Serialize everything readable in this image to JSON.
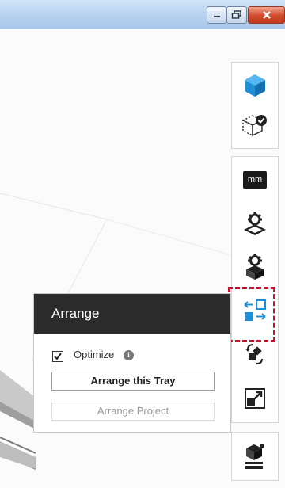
{
  "window": {
    "buttons": [
      {
        "name": "minimize",
        "icon": "minimize-icon"
      },
      {
        "name": "restore",
        "icon": "restore-icon"
      },
      {
        "name": "close",
        "icon": "close-icon"
      }
    ]
  },
  "toolbar": {
    "groups": [
      {
        "items": [
          {
            "icon": "cube-view-icon",
            "color": "#1e8fd6"
          },
          {
            "icon": "dice-check-icon"
          }
        ]
      },
      {
        "items": [
          {
            "icon": "units-mm-icon",
            "label": "mm"
          },
          {
            "icon": "layer-gear-icon"
          },
          {
            "icon": "box-gear-icon"
          },
          {
            "icon": "arrange-icon",
            "color": "#1e8fd6",
            "selected": true
          },
          {
            "icon": "rotate-icon"
          },
          {
            "icon": "scale-icon"
          }
        ]
      },
      {
        "items": [
          {
            "icon": "print-job-icon"
          }
        ]
      }
    ]
  },
  "arrange_panel": {
    "title": "Arrange",
    "optimize_label": "Optimize",
    "optimize_checked": true,
    "arrange_tray_label": "Arrange this Tray",
    "arrange_project_label": "Arrange Project"
  },
  "colors": {
    "accent": "#1e8fd6",
    "highlight": "#c8102e",
    "panel_header": "#2b2b2b"
  }
}
